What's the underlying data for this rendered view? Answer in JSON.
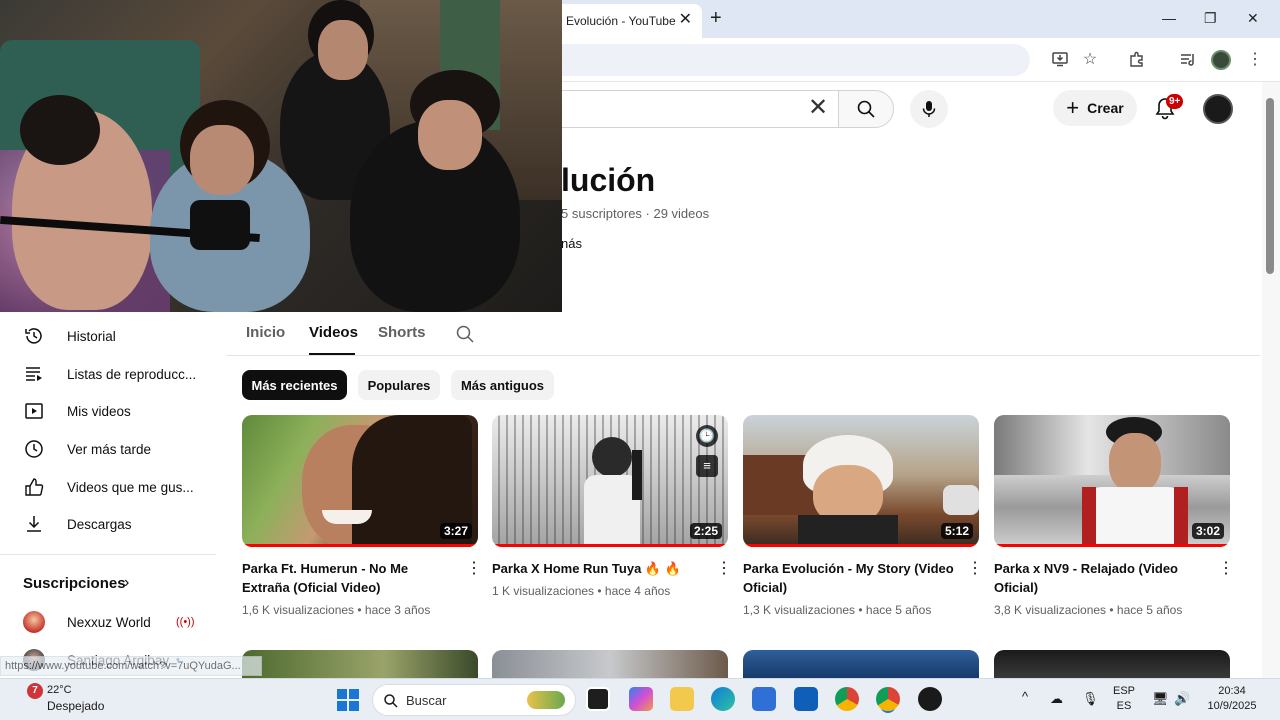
{
  "browser": {
    "tab_title": "Evolución - YouTube",
    "tab_close": "✕",
    "new_tab": "+",
    "window_controls": {
      "minimize": "—",
      "restore": "❐",
      "close": "✕"
    },
    "toolbar_icons": [
      "install-icon",
      "star-icon",
      "extensions-icon",
      "media-icon",
      "profile-icon",
      "menu-icon"
    ]
  },
  "header": {
    "search_clear": "✕",
    "create_label": "Crear",
    "create_plus": "+",
    "notification_badge": "9+"
  },
  "channel": {
    "name": "lución",
    "meta": "5 suscriptores · 29 videos",
    "more": "nás"
  },
  "sidebar": {
    "items": [
      {
        "label": "Historial",
        "icon": "history-icon"
      },
      {
        "label": "Listas de reproducc...",
        "icon": "playlists-icon"
      },
      {
        "label": "Mis videos",
        "icon": "my-videos-icon"
      },
      {
        "label": "Ver más tarde",
        "icon": "watch-later-icon"
      },
      {
        "label": "Videos que me gus...",
        "icon": "liked-icon"
      },
      {
        "label": "Descargas",
        "icon": "download-icon"
      }
    ],
    "subscriptions_title": "Suscripciones",
    "subscriptions_chevron": "›",
    "subscriptions": [
      {
        "name": "Nexxuz World",
        "live": "((•))"
      },
      {
        "name": "Santiago Argibay",
        "live": "•"
      }
    ]
  },
  "tabs": [
    "Inicio",
    "Videos",
    "Shorts"
  ],
  "chips": [
    "Más recientes",
    "Populares",
    "Más antiguos"
  ],
  "videos": [
    {
      "title": "Parka Ft. Humerun - No Me Extraña (Oficial Video)",
      "meta": "1,6 K visualizaciones • hace 3 años",
      "duration": "3:27"
    },
    {
      "title": "Parka X Home Run Tuya 🔥 🔥",
      "meta": "1 K visualizaciones • hace 4 años",
      "duration": "2:25"
    },
    {
      "title": "Parka Evolución - My Story (Video Oficial)",
      "meta": "1,3 K visualizaciones • hace 5 años",
      "duration": "5:12"
    },
    {
      "title": "Parka x NV9 - Relajado (Video Oficial)",
      "meta": "3,8 K visualizaciones • hace 5 años",
      "duration": "3:02"
    }
  ],
  "thumb_overlay": {
    "clock": "🕒",
    "queue": "≡"
  },
  "menu_glyph": "⋮",
  "status_url": "https://www.youtube.com/watch?v=7uQYudaG...",
  "taskbar": {
    "weather_badge": "7",
    "weather_temp": "22°C",
    "weather_desc": "Despejado",
    "search_label": "Buscar",
    "lang_top": "ESP",
    "lang_bottom": "ES",
    "time": "20:34",
    "date": "10/9/2025",
    "tray_chevron": "^"
  },
  "colors": {
    "accent_red": "#ff0000",
    "badge_red": "#cc0000",
    "chip_active": "#0f0f0f",
    "chrome_tabstrip": "#dfe7f4"
  }
}
